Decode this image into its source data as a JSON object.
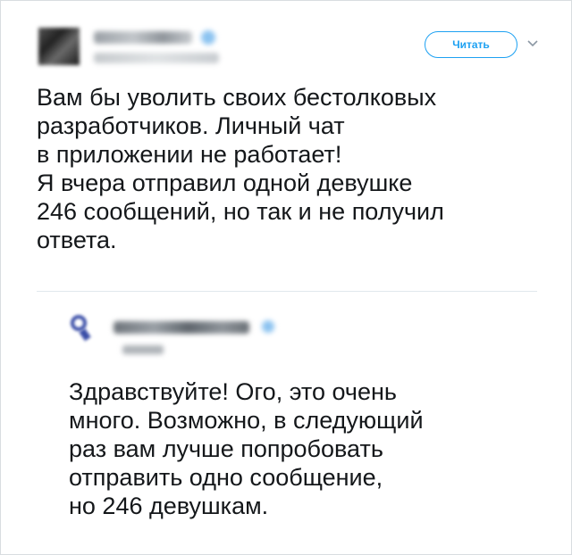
{
  "tweet": {
    "follow_label": "Читать",
    "caret_icon": "chevron-down-icon",
    "text": "Вам бы уволить своих бестолковых\nразработчиков. Личный чат\nв приложении не работает!\nЯ вчера отправил одной девушке\n246 сообщений, но так и не получил\nответа."
  },
  "reply": {
    "text": "Здравствуйте! Ого, это очень\nмного. Возможно, в следующий\nраз вам лучше попробовать\nотправить одно сообщение,\nно 246 девушкам."
  },
  "colors": {
    "accent": "#1da1f2",
    "text": "#14171a",
    "divider": "#e1e8ed"
  }
}
